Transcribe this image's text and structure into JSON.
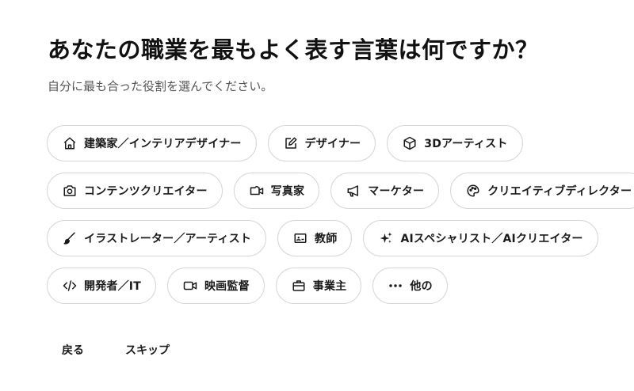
{
  "header": {
    "title": "あなたの職業を最もよく表す言葉は何ですか？",
    "subtitle": "自分に最も合った役割を選んでください。"
  },
  "options": [
    {
      "label": "建築家／インテリアデザイナー",
      "icon": "home-icon"
    },
    {
      "label": "デザイナー",
      "icon": "pen-square-icon"
    },
    {
      "label": "3Dアーティスト",
      "icon": "cube-icon"
    },
    {
      "label": "コンテンツクリエイター",
      "icon": "camera-icon"
    },
    {
      "label": "写真家",
      "icon": "video-camera-icon"
    },
    {
      "label": "マーケター",
      "icon": "megaphone-icon"
    },
    {
      "label": "クリエイティブディレクター",
      "icon": "palette-icon"
    },
    {
      "label": "イラストレーター／アーティスト",
      "icon": "brush-icon"
    },
    {
      "label": "教師",
      "icon": "presentation-board-icon"
    },
    {
      "label": "AIスペシャリスト／AIクリエイター",
      "icon": "sparkles-icon"
    },
    {
      "label": "開発者／IT",
      "icon": "code-icon"
    },
    {
      "label": "映画監督",
      "icon": "film-camera-icon"
    },
    {
      "label": "事業主",
      "icon": "briefcase-icon"
    },
    {
      "label": "他の",
      "icon": "more-dots-icon"
    }
  ],
  "footer": {
    "back_label": "戻る",
    "skip_label": "スキップ"
  }
}
